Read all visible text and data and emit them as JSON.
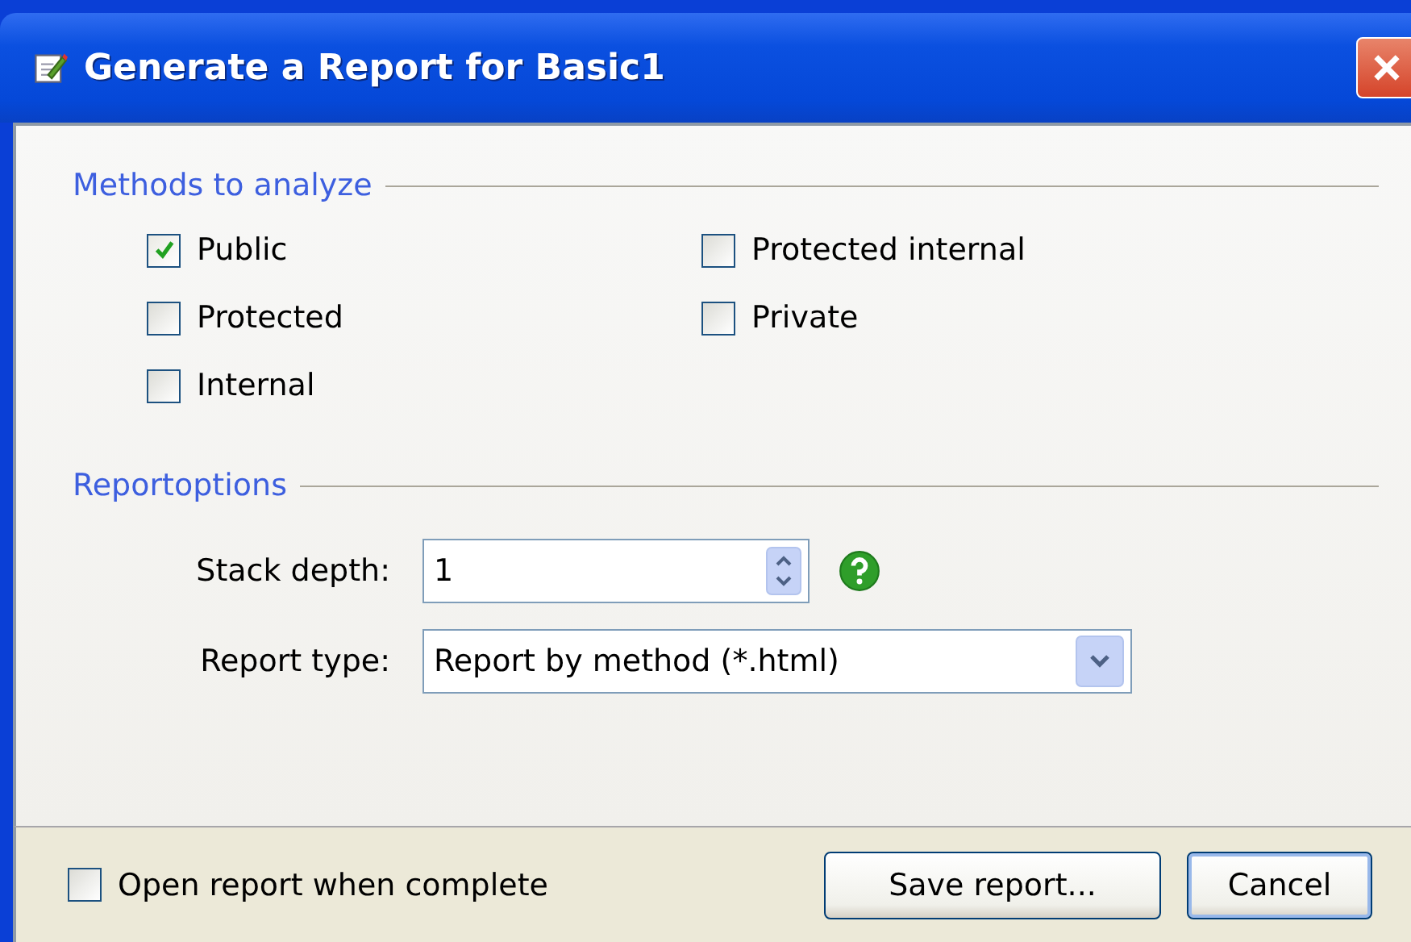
{
  "window": {
    "title": "Generate a Report for Basic1"
  },
  "methods": {
    "title": "Methods to analyze",
    "options": [
      {
        "label": "Public",
        "checked": true
      },
      {
        "label": "Protected",
        "checked": false
      },
      {
        "label": "Internal",
        "checked": false
      },
      {
        "label": "Protected internal",
        "checked": false
      },
      {
        "label": "Private",
        "checked": false
      }
    ]
  },
  "report_options": {
    "title": "Reportoptions",
    "stack_depth": {
      "label": "Stack depth:",
      "value": "1"
    },
    "report_type": {
      "label": "Report type:",
      "value": "Report by method (*.html)"
    }
  },
  "footer": {
    "open_when_complete": {
      "label": "Open report when complete",
      "checked": false
    },
    "buttons": [
      "Save report...",
      "Cancel"
    ]
  }
}
